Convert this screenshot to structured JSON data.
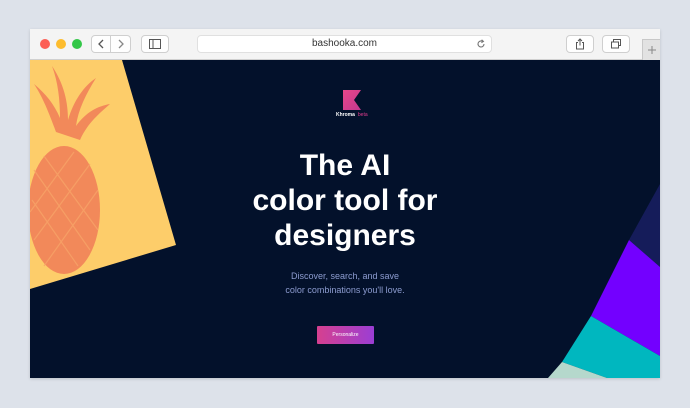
{
  "browser": {
    "url": "bashooka.com"
  },
  "logo": {
    "name": "Khroma",
    "badge": "beta"
  },
  "hero": {
    "line1": "The AI",
    "line2": "color tool for",
    "line3": "designers",
    "subtitle_line1": "Discover, search, and save",
    "subtitle_line2": "color combinations you'll love.",
    "cta_label": "Personalize"
  },
  "colors": {
    "page_bg": "#03112b",
    "card_yellow": "#fdcd6a",
    "pineapple": "#f28b5a",
    "accent_pink": "#d6408f",
    "accent_purple": "#7300ff",
    "accent_teal": "#00b7bf",
    "accent_navy": "#151c5a"
  }
}
